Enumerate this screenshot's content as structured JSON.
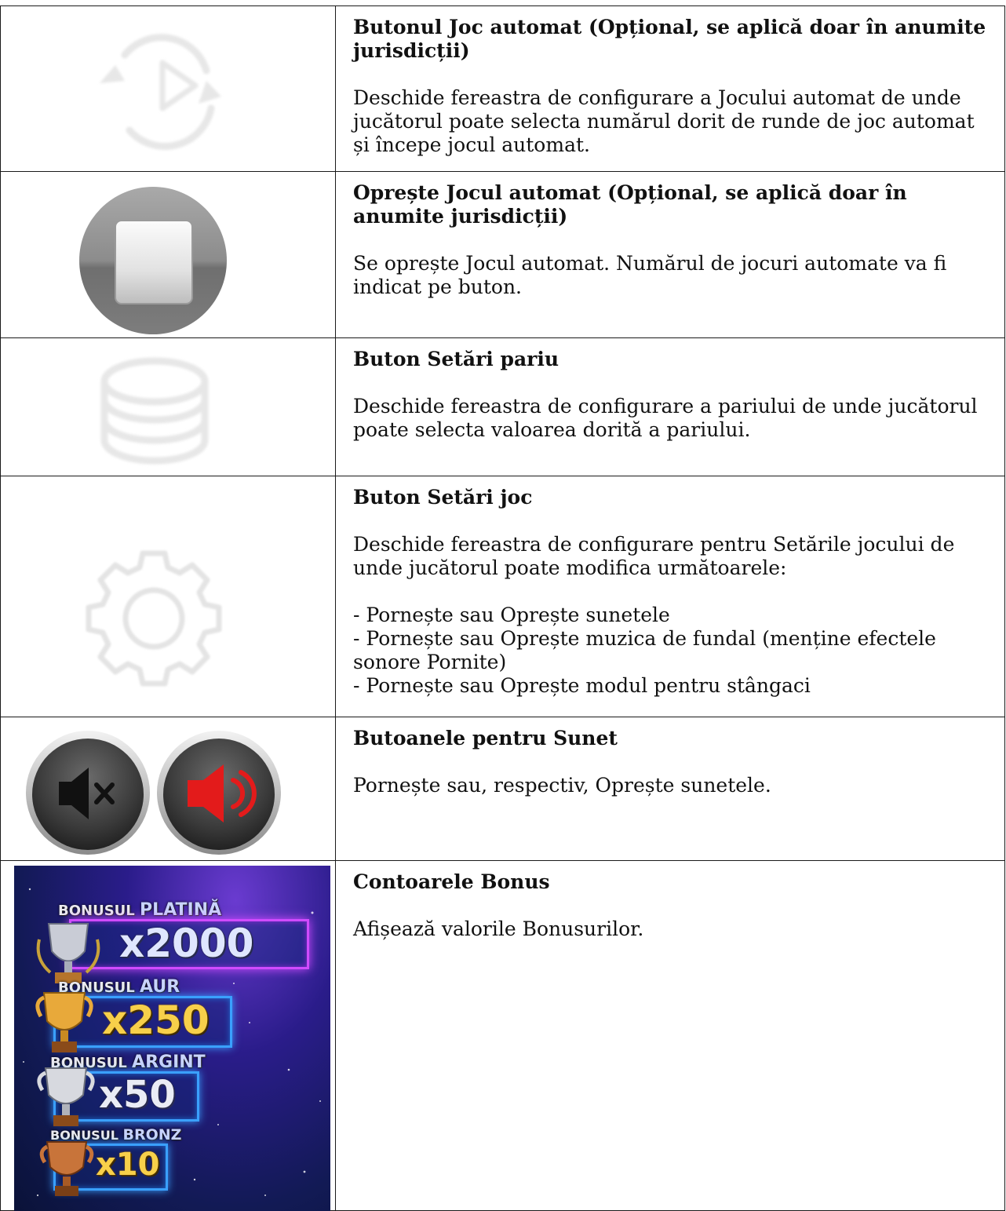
{
  "rows": [
    {
      "icon": "autoplay-icon",
      "title": "Butonul Joc automat (Opțional, se aplică doar în anumite jurisdicții)",
      "desc": "Deschide fereastra de configurare a Jocului automat de unde jucătorul poate selecta numărul dorit de runde de joc automat și începe jocul automat."
    },
    {
      "icon": "stop-autoplay-icon",
      "title": "Oprește Jocul automat (Opțional, se aplică doar în anumite jurisdicții)",
      "desc": "Se oprește Jocul automat. Numărul de jocuri automate va fi indicat pe buton."
    },
    {
      "icon": "coin-stack-icon",
      "title": "Buton Setări pariu",
      "desc": "Deschide fereastra de configurare a pariului de unde jucătorul poate selecta valoarea dorită a pariului."
    },
    {
      "icon": "gear-icon",
      "title": "Buton Setări joc",
      "desc_lines": [
        "Deschide fereastra de configurare pentru Setările jocului de",
        "unde jucătorul poate modifica următoarele:"
      ],
      "list": [
        "- Pornește sau Oprește sunetele",
        "- Pornește sau Oprește muzica de fundal (menține efectele sonore Pornite)",
        "- Pornește sau Oprește modul pentru stângaci"
      ]
    },
    {
      "icon": "sound-buttons-icon",
      "title": "Butoanele pentru Sunet",
      "desc": "Pornește sau, respectiv, Oprește sunetele."
    },
    {
      "icon": "bonus-counters-image",
      "title": "Contoarele Bonus",
      "desc": "Afișează valorile Bonusurilor."
    }
  ],
  "bonus": [
    {
      "label": "BONUSUL",
      "tier": "PLATINĂ",
      "value": "x2000"
    },
    {
      "label": "BONUSUL",
      "tier": "AUR",
      "value": "x250"
    },
    {
      "label": "BONUSUL",
      "tier": "ARGINT",
      "value": "x50"
    },
    {
      "label": "BONUSUL",
      "tier": "BRONZ",
      "value": "x10"
    }
  ]
}
